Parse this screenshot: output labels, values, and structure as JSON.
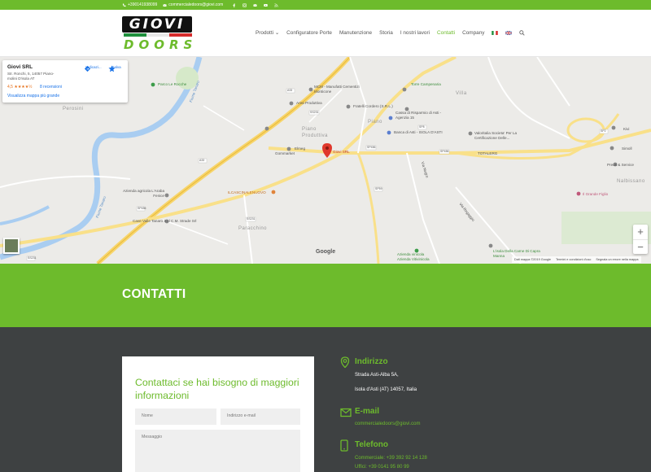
{
  "topbar": {
    "phone": "+390141938099",
    "email": "commercialedoors@giovi.com",
    "social_icons": [
      "facebook-icon",
      "instagram-icon",
      "email-icon",
      "youtube-icon",
      "rss-icon"
    ]
  },
  "logo": {
    "top": "GIOVI",
    "bottom": "DOORS",
    "stripe_colors": [
      "#1e8f3c",
      "#ffffff",
      "#d62b2b"
    ]
  },
  "nav": {
    "items": [
      "Prodotti",
      "Configuratore Porte",
      "Manutenzione",
      "Storia",
      "I nostri lavori",
      "Contatti",
      "Company"
    ],
    "dropdown_indicator": "⌄",
    "active": "Contatti"
  },
  "map": {
    "card": {
      "title": "Giovi SRL",
      "address": "Str. Ronchi, 5, 14057 Piano-molini D'isola AT",
      "rating": "4,5 ★★★★½",
      "reviews": "8 recensioni",
      "link": "Visualizza mappa più grande",
      "directions": "Indicazi...",
      "save": "Salva"
    },
    "labels": {
      "parco": "Parco Le Rocche",
      "perosini": "Perosini",
      "mcm": "MCM - Manufatti Cementizi Monticone",
      "area": "Area Produttiva",
      "fratelli": "Fratelli Cordero (S.R.L.)",
      "cassa": "Cassa di Risparmio di Asti - Agenzia 15",
      "banca": "Banca di Asti - ISOLA D'ASTI",
      "torre": "Torre Campenaria",
      "villa": "Villa",
      "valoritalia": "Valoritalia Societa' Per La Certificazione Delle...",
      "piano": "Piano Produttiva",
      "piano2": "Piano",
      "gommarket": "Gommarket",
      "elmeg": "Elmeg",
      "giovi": "Giovi SRL",
      "totalerg": "TOTALERG",
      "kivi": "Kivi",
      "simoll": "Simoll",
      "preus": "Preus & Service",
      "nalbissano": "Nalbissano",
      "grande_figlio": "Il Grande Figlio",
      "azienda_arabe": "Azienda agricola L'Araba Fenice",
      "cave": "Cave Valle Tanaro S.r.l",
      "ilcascinale": "ILCASCINALENUOVO",
      "cm": "C.M. Strade Srl",
      "paracchino": "Paracchino",
      "azienda_vini": "Azienda vinicola Azienda Vitivinicola",
      "isola": "L'isola Della Carne Di Capra Manna",
      "fiume1": "Fiume Tanaro",
      "fiume2": "Fiume Tanaro",
      "vianegro": "Via Negro",
      "via_reg": "Via Regaggio"
    },
    "roads": [
      "A33",
      "A33",
      "SS231",
      "SS231",
      "SP456",
      "SP456",
      "SP8",
      "SP59",
      "SP456",
      "SP2",
      "SS231"
    ],
    "footer": {
      "data": "Dati mappa ©2019 Google",
      "terms": "Termini e condizioni d'uso",
      "report": "Segnala un errore nella mappa"
    },
    "google": "Google",
    "zoom_in": "+",
    "zoom_out": "−"
  },
  "banner": {
    "title": "CONTATTI"
  },
  "form": {
    "title": "Contattaci se hai bisogno di maggiori informazioni",
    "name_placeholder": "Nome",
    "email_placeholder": "Indirizzo e-mail",
    "message_placeholder": "Messaggio"
  },
  "info": {
    "address_heading": "Indirizzo",
    "address_line1": "Strada Asti-Alba 5A,",
    "address_line2": "Isola d'Asti (AT) 14057, Italia",
    "email_heading": "E-mail",
    "email_value": "commercialedoors@giovi.com",
    "phone_heading": "Telefono",
    "phone_commercial": "Commerciale: +39 392 92 14 128",
    "phone_office": "Uffici: +39 0141 95 80 99"
  },
  "colors": {
    "accent": "#6dbb2c",
    "dark": "#3e4142",
    "map_bg": "#ecebe8"
  }
}
